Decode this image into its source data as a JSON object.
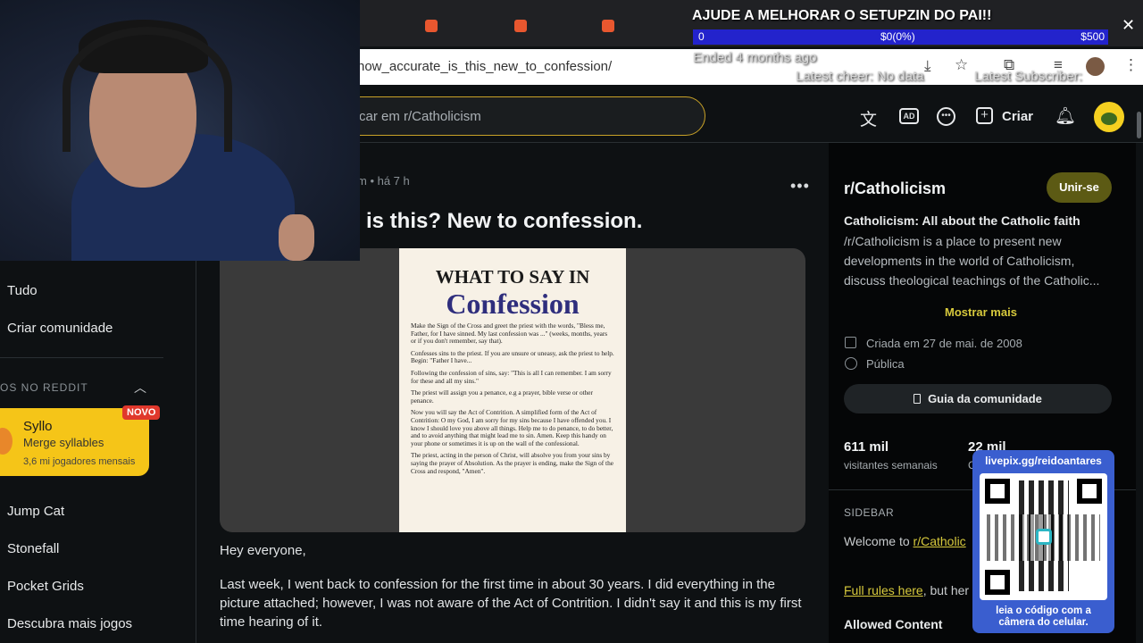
{
  "browser": {
    "url": "how_accurate_is_this_new_to_confession/"
  },
  "reddit_header": {
    "search_placeholder": "car em r/Catholicism",
    "create_label": "Criar"
  },
  "post": {
    "meta": "m • há 7 h",
    "title": "is this? New to confession.",
    "body_1": "Hey everyone,",
    "body_2": "Last week, I went back to confession for the first time in about 30 years. I did everything in the picture attached; however, I was not aware of the Act of Contrition. I didn't say it and this is my first time hearing of it.",
    "image": {
      "heading_top": "WHAT TO SAY IN",
      "heading_main": "Confession",
      "paragraphs": [
        "Make the Sign of the Cross and greet the priest with the words, \"Bless me, Father, for I have sinned. My last confession was ...\" (weeks, months, years or if you don't remember, say that).",
        "Confesses sins to the priest. If you are unsure or uneasy, ask the priest to help. Begin: \"Father I have...",
        "Following the confession of sins, say: \"This is all I can remember. I am sorry for these and all my sins.\"",
        "The priest will assign you a penance, e.g a prayer, bible verse or other penance.",
        "Now you will say the Act of Contrition. A simplified form of the Act of Contrition: O my God, I am sorry for my sins because I have offended you. I know I should love you above all things. Help me to do penance, to do better, and to avoid anything that might lead me to sin. Amen. Keep this handy on your phone or sometimes it is up on the wall of the confessional.",
        "The priest, acting in the person of Christ, will absolve you from your sins by saying the prayer of Absolution. As the prayer is ending, make the Sign of the Cross and respond, \"Amen\"."
      ]
    }
  },
  "left_nav": {
    "items": [
      "Tudo",
      "Criar comunidade"
    ],
    "games_heading": "OS NO REDDIT",
    "featured_game": {
      "name": "Syllo",
      "subtitle": "Merge syllables",
      "players": "3,6 mi jogadores mensais",
      "badge": "NOVO"
    },
    "games": [
      "Jump Cat",
      "Stonefall",
      "Pocket Grids",
      "Descubra mais jogos"
    ]
  },
  "community": {
    "name": "r/Catholicism",
    "join_label": "Unir-se",
    "tagline": "Catholicism: All about the Catholic faith",
    "description": "/r/Catholicism is a place to present new developments in the world of Catholicism, discuss theological teachings of the Catholic...",
    "show_more": "Mostrar mais",
    "created": "Criada em 27 de mai. de 2008",
    "visibility": "Pública",
    "guide_label": "Guia da comunidade",
    "visitors_value": "611 mil",
    "visitors_label": "visitantes semanais",
    "contrib_value": "22 mil",
    "contrib_label": "C",
    "sidebar_heading": "SIDEBAR",
    "welcome_text": "Welcome to ",
    "welcome_link": "r/Catholic",
    "rules_link": "Full rules here",
    "rules_rest": ", but her",
    "allowed_heading": "Allowed Content"
  },
  "stream_overlay": {
    "goal_title": "AJUDE A MELHORAR O SETUPZIN DO PAI!!",
    "goal_min": "0",
    "goal_current": "$0(0%)",
    "goal_max": "$500",
    "ended": "Ended 4 months ago",
    "latest_cheer": "Latest cheer: No data",
    "latest_sub": "Latest Subscriber:",
    "qr_url": "livepix.gg/reidoantares",
    "qr_caption": "leia o código com a câmera do celular."
  },
  "colors": {
    "accent_gold": "#c9a227",
    "join_button": "#5c5a14",
    "link": "#d7c93c",
    "goal_bar": "#2323cc",
    "qr_panel": "#3a5ecf",
    "badge_red": "#e0382c",
    "syllo_yellow": "#f5c518"
  }
}
